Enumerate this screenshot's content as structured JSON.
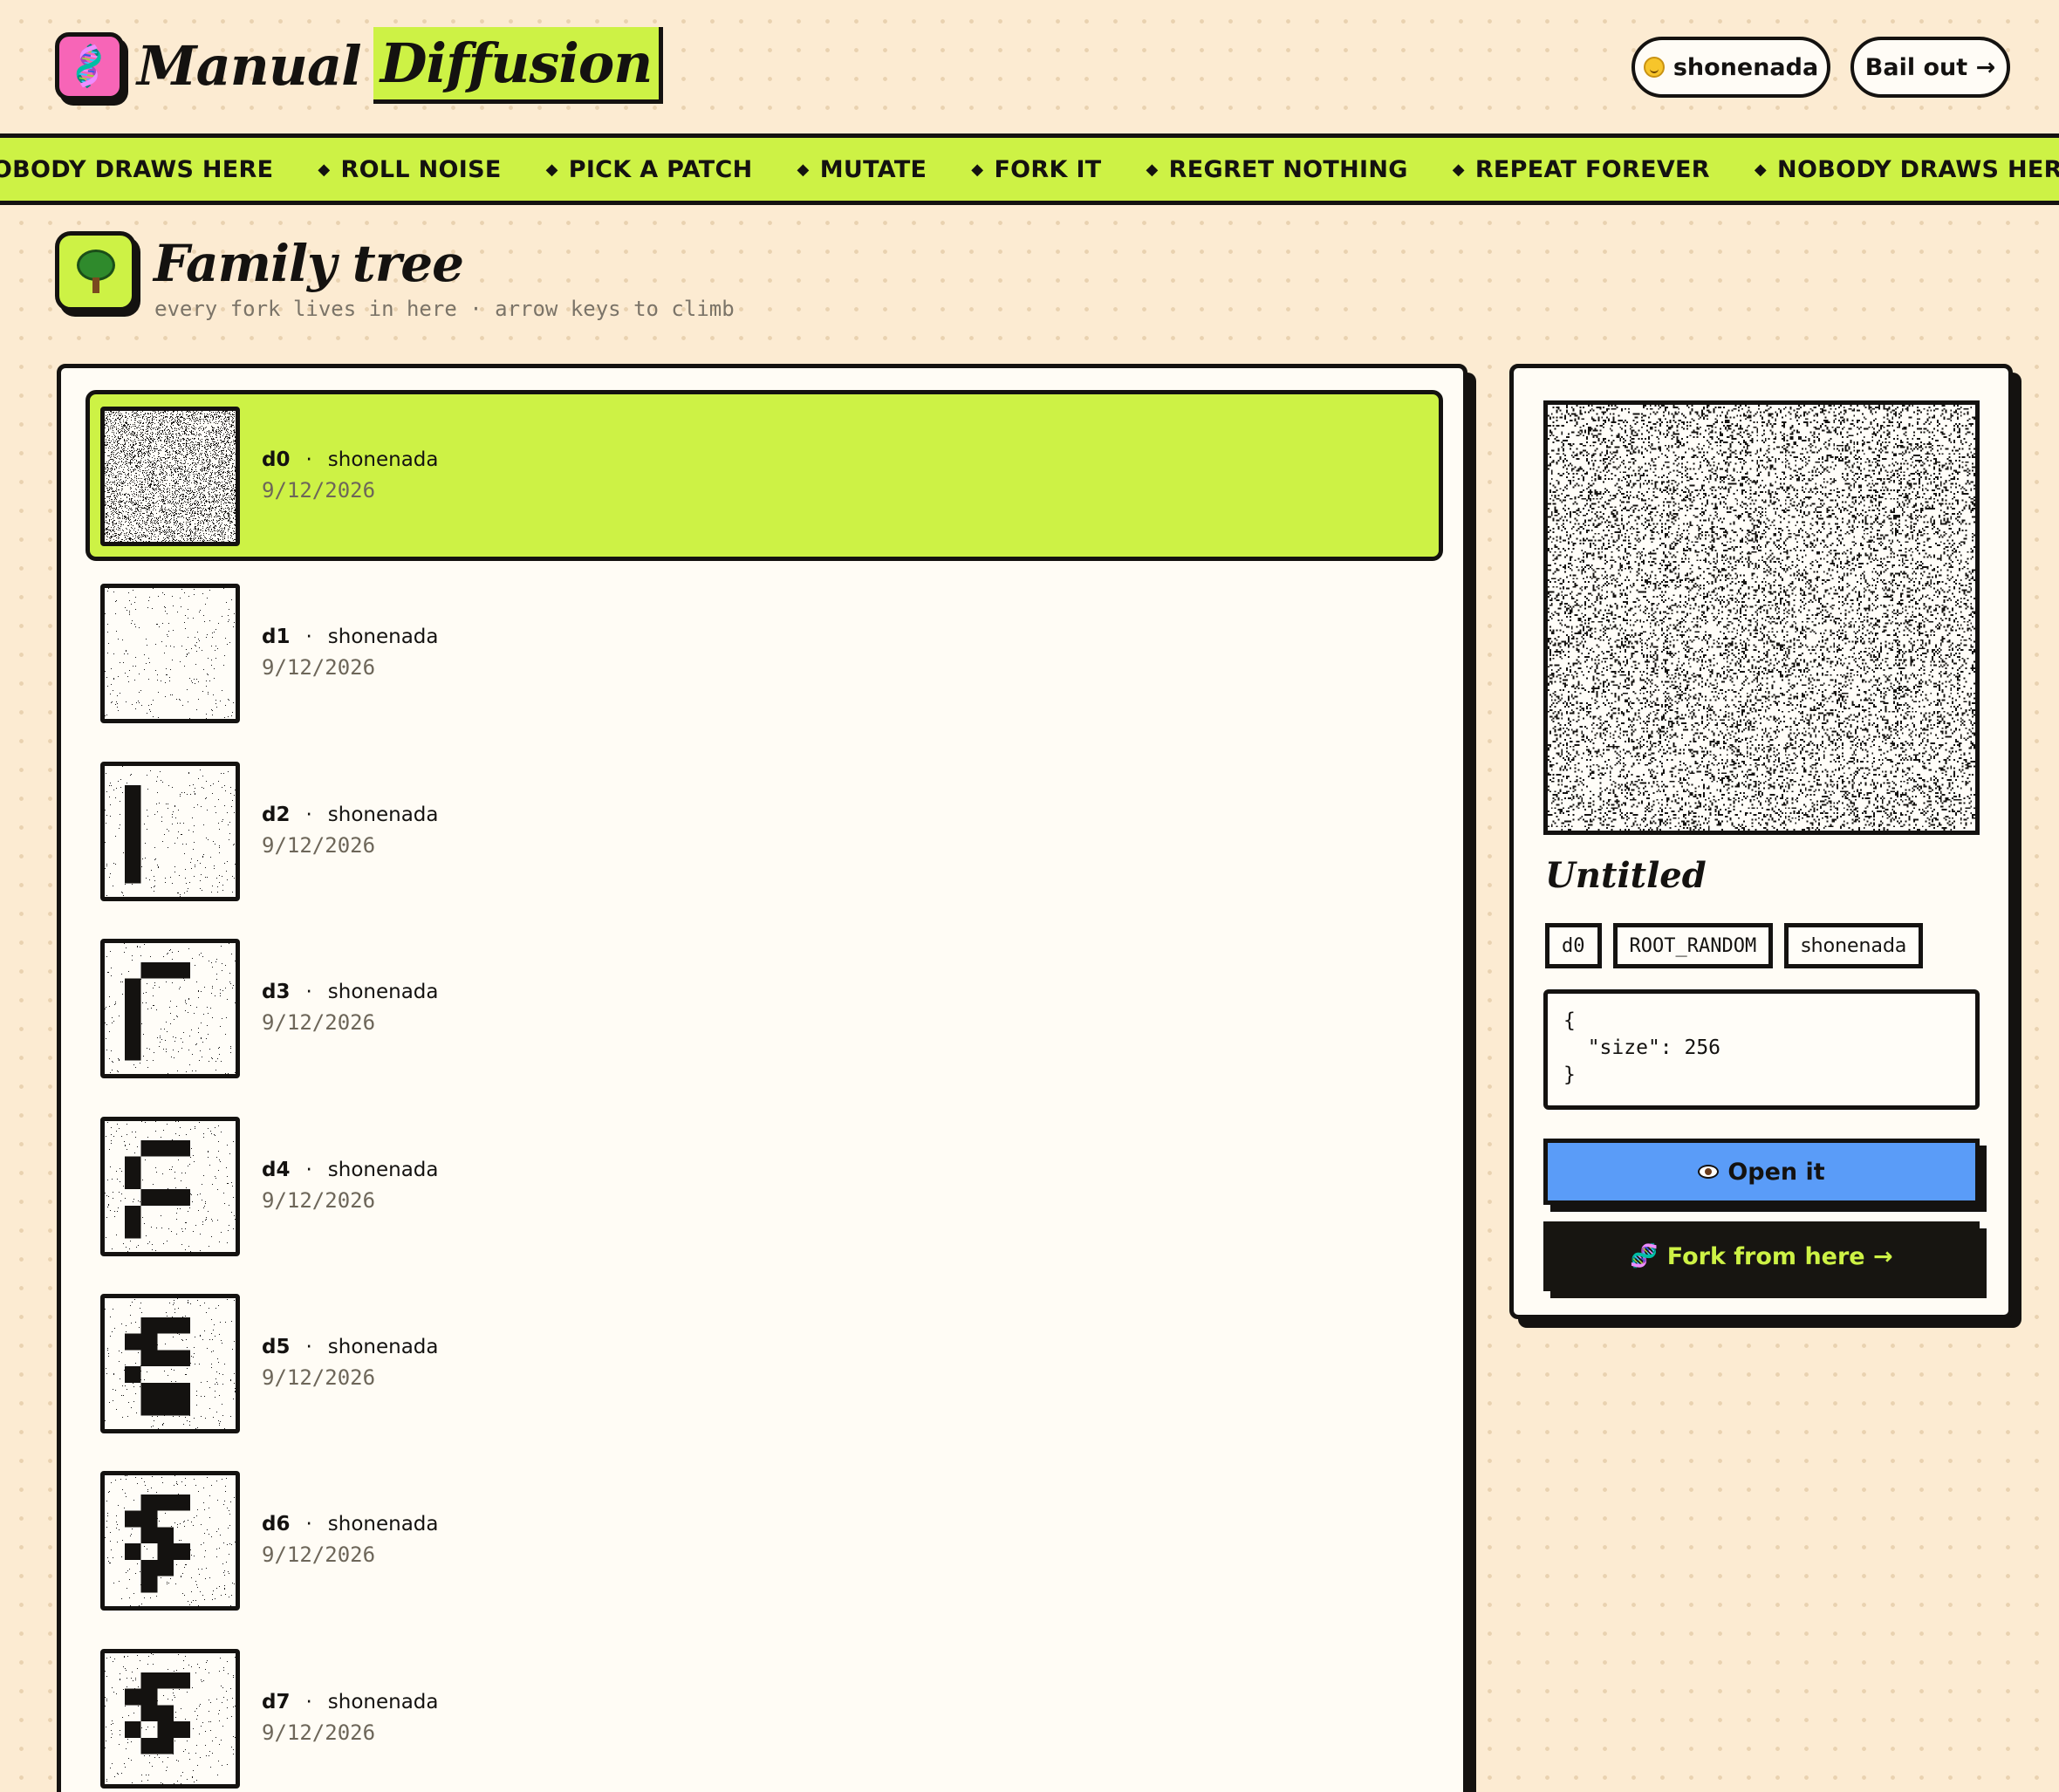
{
  "brand": {
    "name_part1": "Manual",
    "name_part2": "Diffusion",
    "logo_icon": "dna-icon",
    "accent": "#cdf245",
    "logo_bg": "#f765b7"
  },
  "header": {
    "user_label": "shonenada",
    "user_icon": "smiley-face-icon",
    "bail_label": "Bail out →"
  },
  "marquee": {
    "items": [
      "NOBODY DRAWS HERE",
      "ROLL NOISE",
      "PICK A PATCH",
      "MUTATE",
      "FORK IT",
      "REGRET NOTHING",
      "REPEAT FOREVER",
      "NOBODY DRAWS HERE"
    ],
    "separator": "◆"
  },
  "section": {
    "icon": "tree-icon",
    "title": "Family tree",
    "subtitle": "every fork lives in here · arrow keys to climb"
  },
  "tree": {
    "nodes": [
      {
        "id": "d0",
        "author": "shonenada",
        "date": "9/12/2026",
        "selected": true
      },
      {
        "id": "d1",
        "author": "shonenada",
        "date": "9/12/2026",
        "selected": false
      },
      {
        "id": "d2",
        "author": "shonenada",
        "date": "9/12/2026",
        "selected": false
      },
      {
        "id": "d3",
        "author": "shonenada",
        "date": "9/12/2026",
        "selected": false
      },
      {
        "id": "d4",
        "author": "shonenada",
        "date": "9/12/2026",
        "selected": false
      },
      {
        "id": "d5",
        "author": "shonenada",
        "date": "9/12/2026",
        "selected": false
      },
      {
        "id": "d6",
        "author": "shonenada",
        "date": "9/12/2026",
        "selected": false
      },
      {
        "id": "d7",
        "author": "shonenada",
        "date": "9/12/2026",
        "selected": false
      }
    ],
    "separator": "·"
  },
  "detail": {
    "title": "Untitled",
    "chips": [
      "d0",
      "ROOT_RANDOM",
      "shonenada"
    ],
    "params_open": "{",
    "params_line": "\"size\": 256",
    "params_close": "}",
    "open_label": "Open it",
    "open_icon": "eye-icon",
    "open_color": "#5a9cf8",
    "fork_label": "Fork from here →",
    "fork_icon": "dna-icon"
  }
}
